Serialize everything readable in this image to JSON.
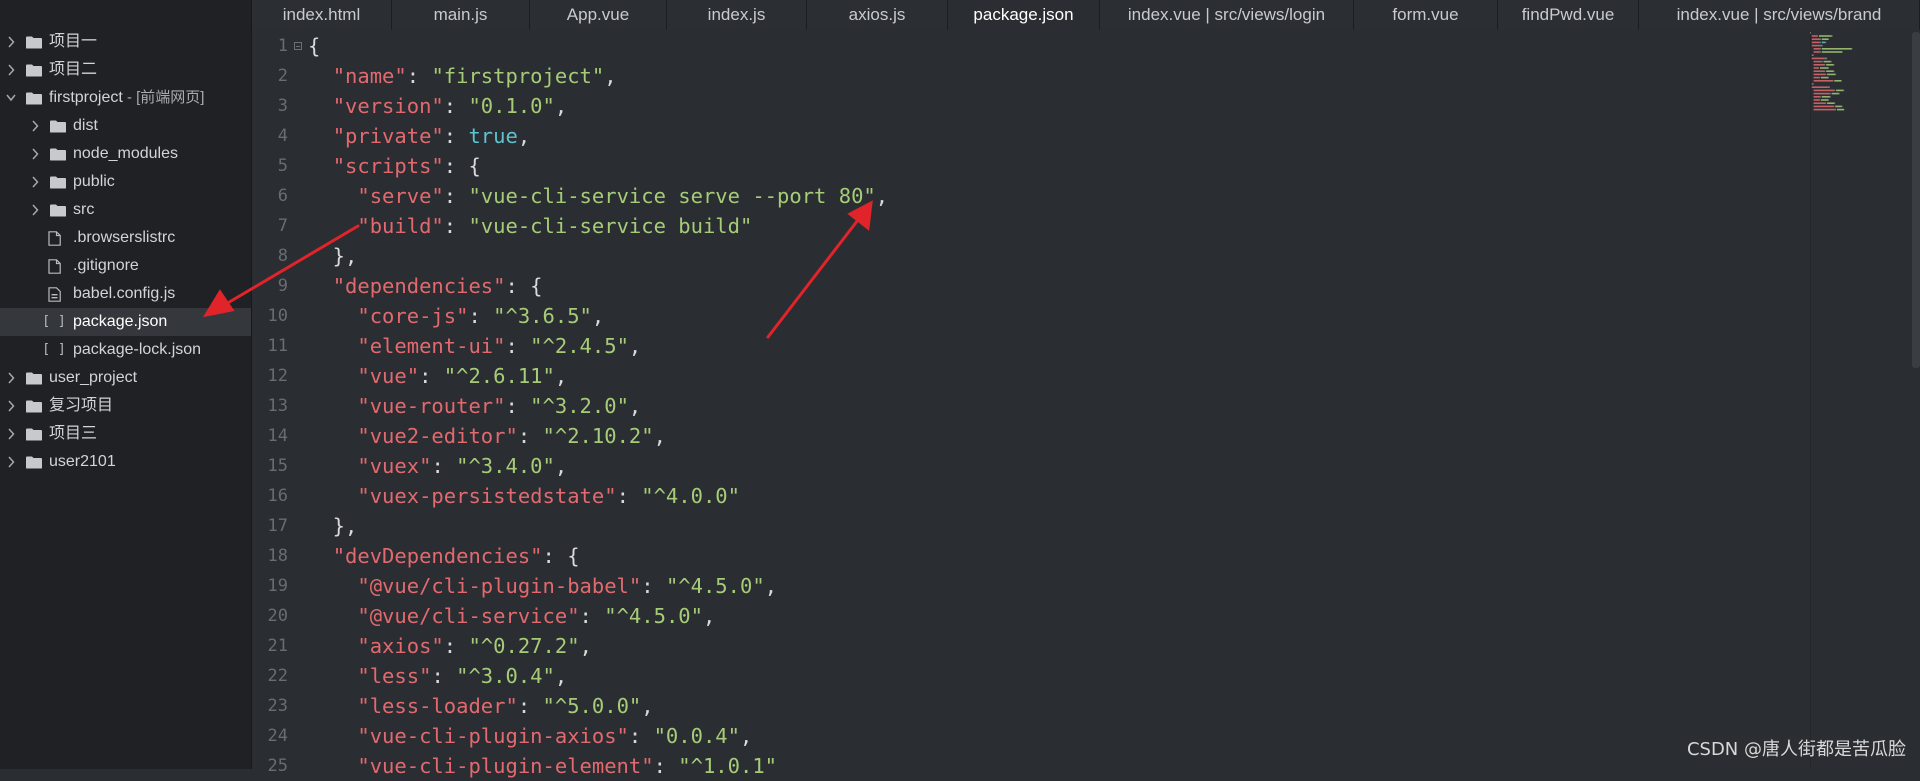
{
  "sidebar": {
    "items": [
      {
        "label": "项目一",
        "kind": "folder",
        "depth": 0,
        "state": "collapsed"
      },
      {
        "label": "项目二",
        "kind": "folder",
        "depth": 0,
        "state": "collapsed"
      },
      {
        "label": "firstproject",
        "sub": " - [前端网页]",
        "kind": "folder",
        "depth": 0,
        "state": "expanded"
      },
      {
        "label": "dist",
        "kind": "folder",
        "depth": 1,
        "state": "collapsed"
      },
      {
        "label": "node_modules",
        "kind": "folder",
        "depth": 1,
        "state": "collapsed"
      },
      {
        "label": "public",
        "kind": "folder",
        "depth": 1,
        "state": "collapsed"
      },
      {
        "label": "src",
        "kind": "folder",
        "depth": 1,
        "state": "collapsed"
      },
      {
        "label": ".browserslistrc",
        "kind": "file",
        "icon": "file-icon",
        "depth": 1
      },
      {
        "label": ".gitignore",
        "kind": "file",
        "icon": "file-icon",
        "depth": 1
      },
      {
        "label": "babel.config.js",
        "kind": "file",
        "icon": "js-file-icon",
        "depth": 1
      },
      {
        "label": "package.json",
        "kind": "file",
        "icon": "json-file-icon",
        "depth": 1,
        "selected": true
      },
      {
        "label": "package-lock.json",
        "kind": "file",
        "icon": "json-file-icon",
        "depth": 1
      },
      {
        "label": "user_project",
        "kind": "folder",
        "depth": 0,
        "state": "collapsed"
      },
      {
        "label": "复习项目",
        "kind": "folder",
        "depth": 0,
        "state": "collapsed"
      },
      {
        "label": "项目三",
        "kind": "folder",
        "depth": 0,
        "state": "collapsed"
      },
      {
        "label": "user2101",
        "kind": "folder",
        "depth": 0,
        "state": "collapsed"
      }
    ]
  },
  "tabs": [
    {
      "label": "index.html"
    },
    {
      "label": "main.js"
    },
    {
      "label": "App.vue"
    },
    {
      "label": "index.js"
    },
    {
      "label": "axios.js"
    },
    {
      "label": "package.json",
      "active": true
    },
    {
      "label": "index.vue | src/views/login"
    },
    {
      "label": "form.vue"
    },
    {
      "label": "findPwd.vue"
    },
    {
      "label": "index.vue | src/views/brand"
    }
  ],
  "editor": {
    "line_numbers": [
      "1",
      "2",
      "3",
      "4",
      "5",
      "6",
      "7",
      "8",
      "9",
      "10",
      "11",
      "12",
      "13",
      "14",
      "15",
      "16",
      "17",
      "18",
      "19",
      "20",
      "21",
      "22",
      "23",
      "24",
      "25"
    ],
    "lines": [
      [
        [
          "p",
          "{"
        ]
      ],
      [
        [
          "p",
          "  "
        ],
        [
          "k",
          "\"name\""
        ],
        [
          "p",
          ": "
        ],
        [
          "s",
          "\"firstproject\""
        ],
        [
          "p",
          ","
        ]
      ],
      [
        [
          "p",
          "  "
        ],
        [
          "k",
          "\"version\""
        ],
        [
          "p",
          ": "
        ],
        [
          "s",
          "\"0.1.0\""
        ],
        [
          "p",
          ","
        ]
      ],
      [
        [
          "p",
          "  "
        ],
        [
          "k",
          "\"private\""
        ],
        [
          "p",
          ": "
        ],
        [
          "b",
          "true"
        ],
        [
          "p",
          ","
        ]
      ],
      [
        [
          "p",
          "  "
        ],
        [
          "k",
          "\"scripts\""
        ],
        [
          "p",
          ": {"
        ]
      ],
      [
        [
          "p",
          "    "
        ],
        [
          "k",
          "\"serve\""
        ],
        [
          "p",
          ": "
        ],
        [
          "s",
          "\"vue-cli-service serve --port 80\""
        ],
        [
          "p",
          ","
        ]
      ],
      [
        [
          "p",
          "    "
        ],
        [
          "k",
          "\"build\""
        ],
        [
          "p",
          ": "
        ],
        [
          "s",
          "\"vue-cli-service build\""
        ]
      ],
      [
        [
          "p",
          "  },"
        ]
      ],
      [
        [
          "p",
          "  "
        ],
        [
          "k",
          "\"dependencies\""
        ],
        [
          "p",
          ": {"
        ]
      ],
      [
        [
          "p",
          "    "
        ],
        [
          "k",
          "\"core-js\""
        ],
        [
          "p",
          ": "
        ],
        [
          "s",
          "\"^3.6.5\""
        ],
        [
          "p",
          ","
        ]
      ],
      [
        [
          "p",
          "    "
        ],
        [
          "k",
          "\"element-ui\""
        ],
        [
          "p",
          ": "
        ],
        [
          "s",
          "\"^2.4.5\""
        ],
        [
          "p",
          ","
        ]
      ],
      [
        [
          "p",
          "    "
        ],
        [
          "k",
          "\"vue\""
        ],
        [
          "p",
          ": "
        ],
        [
          "s",
          "\"^2.6.11\""
        ],
        [
          "p",
          ","
        ]
      ],
      [
        [
          "p",
          "    "
        ],
        [
          "k",
          "\"vue-router\""
        ],
        [
          "p",
          ": "
        ],
        [
          "s",
          "\"^3.2.0\""
        ],
        [
          "p",
          ","
        ]
      ],
      [
        [
          "p",
          "    "
        ],
        [
          "k",
          "\"vue2-editor\""
        ],
        [
          "p",
          ": "
        ],
        [
          "s",
          "\"^2.10.2\""
        ],
        [
          "p",
          ","
        ]
      ],
      [
        [
          "p",
          "    "
        ],
        [
          "k",
          "\"vuex\""
        ],
        [
          "p",
          ": "
        ],
        [
          "s",
          "\"^3.4.0\""
        ],
        [
          "p",
          ","
        ]
      ],
      [
        [
          "p",
          "    "
        ],
        [
          "k",
          "\"vuex-persistedstate\""
        ],
        [
          "p",
          ": "
        ],
        [
          "s",
          "\"^4.0.0\""
        ]
      ],
      [
        [
          "p",
          "  },"
        ]
      ],
      [
        [
          "p",
          "  "
        ],
        [
          "k",
          "\"devDependencies\""
        ],
        [
          "p",
          ": {"
        ]
      ],
      [
        [
          "p",
          "    "
        ],
        [
          "k",
          "\"@vue/cli-plugin-babel\""
        ],
        [
          "p",
          ": "
        ],
        [
          "s",
          "\"^4.5.0\""
        ],
        [
          "p",
          ","
        ]
      ],
      [
        [
          "p",
          "    "
        ],
        [
          "k",
          "\"@vue/cli-service\""
        ],
        [
          "p",
          ": "
        ],
        [
          "s",
          "\"^4.5.0\""
        ],
        [
          "p",
          ","
        ]
      ],
      [
        [
          "p",
          "    "
        ],
        [
          "k",
          "\"axios\""
        ],
        [
          "p",
          ": "
        ],
        [
          "s",
          "\"^0.27.2\""
        ],
        [
          "p",
          ","
        ]
      ],
      [
        [
          "p",
          "    "
        ],
        [
          "k",
          "\"less\""
        ],
        [
          "p",
          ": "
        ],
        [
          "s",
          "\"^3.0.4\""
        ],
        [
          "p",
          ","
        ]
      ],
      [
        [
          "p",
          "    "
        ],
        [
          "k",
          "\"less-loader\""
        ],
        [
          "p",
          ": "
        ],
        [
          "s",
          "\"^5.0.0\""
        ],
        [
          "p",
          ","
        ]
      ],
      [
        [
          "p",
          "    "
        ],
        [
          "k",
          "\"vue-cli-plugin-axios\""
        ],
        [
          "p",
          ": "
        ],
        [
          "s",
          "\"0.0.4\""
        ],
        [
          "p",
          ","
        ]
      ],
      [
        [
          "p",
          "    "
        ],
        [
          "k",
          "\"vue-cli-plugin-element\""
        ],
        [
          "p",
          ": "
        ],
        [
          "s",
          "\"^1.0.1\""
        ]
      ]
    ]
  },
  "watermark": "CSDN @唐人街都是苦瓜脸",
  "colors": {
    "key": "#e26a6f",
    "string": "#a7cc77",
    "boolean": "#5cc3cf",
    "annotation_arrow": "#e0242a"
  }
}
